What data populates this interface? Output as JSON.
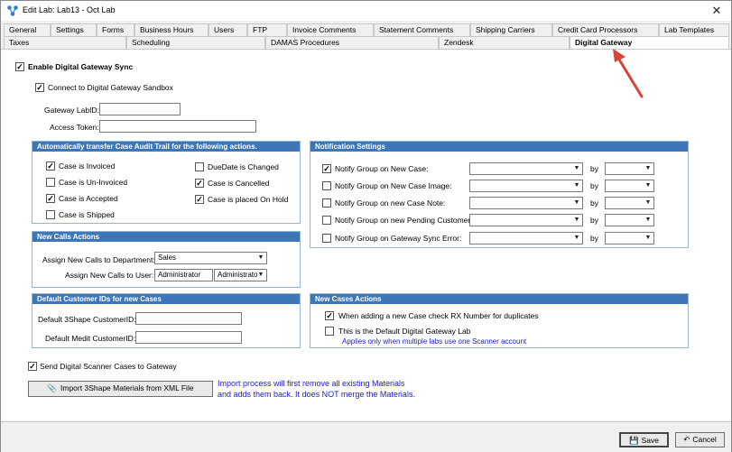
{
  "window": {
    "title": "Edit Lab: Lab13 - Oct Lab"
  },
  "tabs_row1": [
    "General",
    "Settings",
    "Forms",
    "Business Hours",
    "Users",
    "FTP",
    "Invoice Comments",
    "Statement Comments",
    "Shipping Carriers",
    "Credit Card Processors",
    "Lab Templates"
  ],
  "tabs_row2": [
    "Taxes",
    "Scheduling",
    "DAMAS Procedures",
    "Zendesk",
    "Digital Gateway"
  ],
  "active_tab": "Digital Gateway",
  "main": {
    "enable_sync": "Enable Digital Gateway Sync",
    "sandbox": "Connect to Digital Gateway Sandbox",
    "gateway_labid_label": "Gateway LabID:",
    "gateway_labid_value": "",
    "access_token_label": "Access Token:",
    "access_token_value": ""
  },
  "audit": {
    "header": "Automatically transfer Case Audit Trail for the following actions.",
    "items": [
      {
        "label": "Case is Invoiced",
        "checked": "✓"
      },
      {
        "label": "Case is Un-Invoiced",
        "checked": ""
      },
      {
        "label": "Case is Accepted",
        "checked": "✓"
      },
      {
        "label": "Case is Shipped",
        "checked": ""
      },
      {
        "label": "DueDate is Changed",
        "checked": ""
      },
      {
        "label": "Case is Cancelled",
        "checked": "✓"
      },
      {
        "label": "Case is placed On Hold",
        "checked": "✓"
      }
    ]
  },
  "notify": {
    "header": "Notification Settings",
    "by": "by",
    "items": [
      {
        "label": "Notify Group on New Case:",
        "checked": "✓"
      },
      {
        "label": "Notify Group on New Case Image:",
        "checked": ""
      },
      {
        "label": "Notify Group on new Case Note:",
        "checked": ""
      },
      {
        "label": "Notify Group on new Pending Customer:",
        "checked": ""
      },
      {
        "label": "Notify Group on Gateway Sync Error:",
        "checked": ""
      }
    ]
  },
  "calls": {
    "header": "New Calls Actions",
    "dept_label": "Assign New Calls to Department:",
    "dept_value": "Sales",
    "user_label": "Assign New Calls to User:",
    "user_value": "Administrator",
    "user_value2": "Administrato"
  },
  "custids": {
    "header": "Default Customer IDs for new Cases",
    "shape_label": "Default 3Shape CustomerID:",
    "shape_value": "",
    "medit_label": "Default Medit CustomerID:",
    "medit_value": ""
  },
  "newcases": {
    "header": "New Cases Actions",
    "rx_label": "When adding a new Case check RX Number for duplicates",
    "default_label": "This is the Default Digital Gateway Lab",
    "note": "Applies only when multiple labs use one Scanner account"
  },
  "scanner": {
    "send_label": "Send Digital Scanner Cases to Gateway",
    "import_button": "Import 3Shape Materials from XML File",
    "import_note1": "Import process will first remove all existing Materials",
    "import_note2": "and adds them back. It does NOT merge the Materials."
  },
  "buttons": {
    "save": "Save",
    "cancel": "Cancel"
  },
  "colors": {
    "group_header": "#3d77b8",
    "note_blue": "#1b1bd0",
    "arrow_red": "#d9423b"
  }
}
